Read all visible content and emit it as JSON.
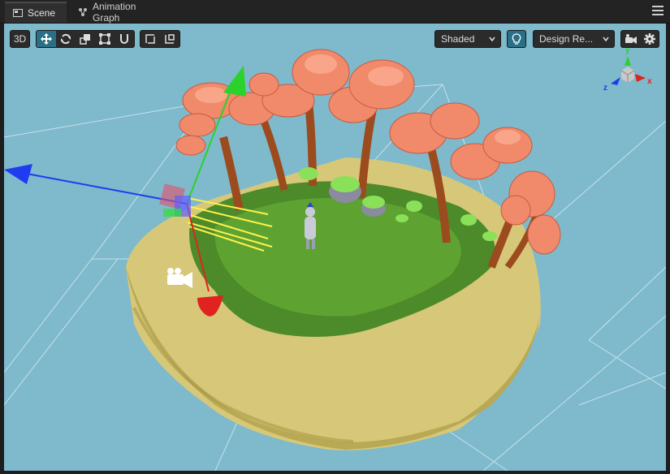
{
  "tabs": [
    {
      "label": "Scene",
      "icon": "scene-icon",
      "active": true
    },
    {
      "label": "Animation Graph",
      "icon": "animation-graph-icon",
      "active": false
    }
  ],
  "toolbar": {
    "mode_label": "3D",
    "tools": [
      {
        "name": "move-tool",
        "icon": "move-arrows-icon",
        "active": true
      },
      {
        "name": "rotate-tool",
        "icon": "rotate-icon",
        "active": false
      },
      {
        "name": "scale-tool",
        "icon": "scale-icon",
        "active": false
      },
      {
        "name": "rect-tool",
        "icon": "rect-icon",
        "active": false
      },
      {
        "name": "snap-tool",
        "icon": "magnet-icon",
        "active": false
      }
    ],
    "pivot_tools": [
      {
        "name": "pivot-local",
        "icon": "pivot-local-icon"
      },
      {
        "name": "pivot-global",
        "icon": "pivot-global-icon"
      }
    ],
    "shading_value": "Shaded",
    "lighting_icon": "lightbulb-icon",
    "resolution_value": "Design Re...",
    "camera_icon": "camera-icon",
    "settings_icon": "gear-icon"
  },
  "axis_gizmo": {
    "x": "x",
    "y": "y",
    "z": "z"
  },
  "colors": {
    "viewport_bg": "#7fb9cc",
    "accent": "#2a6f85",
    "x_axis": "#e0231f",
    "y_axis": "#2bd22b",
    "z_axis": "#1f3cf0"
  }
}
